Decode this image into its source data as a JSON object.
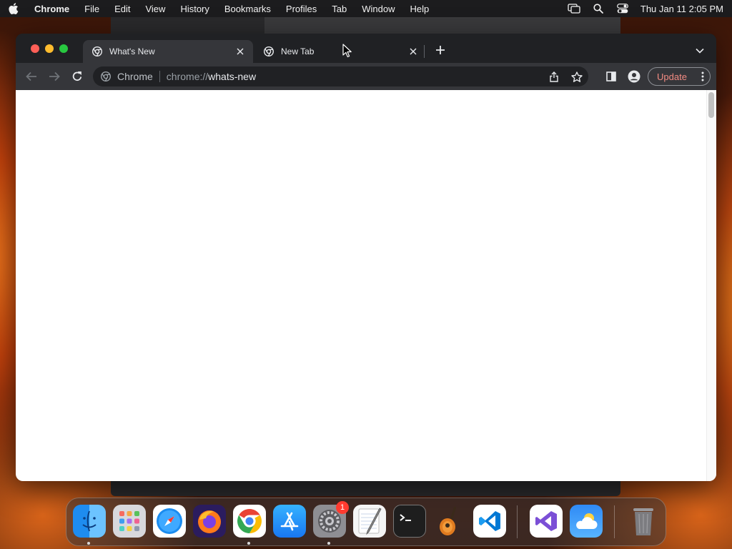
{
  "menubar": {
    "app_name": "Chrome",
    "items": [
      "File",
      "Edit",
      "View",
      "History",
      "Bookmarks",
      "Profiles",
      "Tab",
      "Window",
      "Help"
    ],
    "clock": "Thu Jan 11  2:05 PM"
  },
  "browser": {
    "tabs": [
      {
        "title": "What's New",
        "active": true,
        "icon": "chrome-icon"
      },
      {
        "title": "New Tab",
        "active": false,
        "icon": "chrome-icon"
      }
    ],
    "omnibox": {
      "chip_label": "Chrome",
      "url_scheme": "chrome://",
      "url_host": "whats-new"
    },
    "update_label": "Update"
  },
  "dock": {
    "apps": [
      "Finder",
      "Launchpad",
      "Safari",
      "Firefox",
      "Google Chrome",
      "App Store",
      "System Settings",
      "TextEdit",
      "Terminal",
      "GarageBand",
      "Visual Studio Code",
      "Visual Studio",
      "Weather",
      "Trash"
    ],
    "settings_badge": "1"
  },
  "colors": {
    "accent_update": "#f28b82",
    "window_frame": "#202124",
    "toolbar": "#35363a",
    "badge": "#ff3b30"
  }
}
